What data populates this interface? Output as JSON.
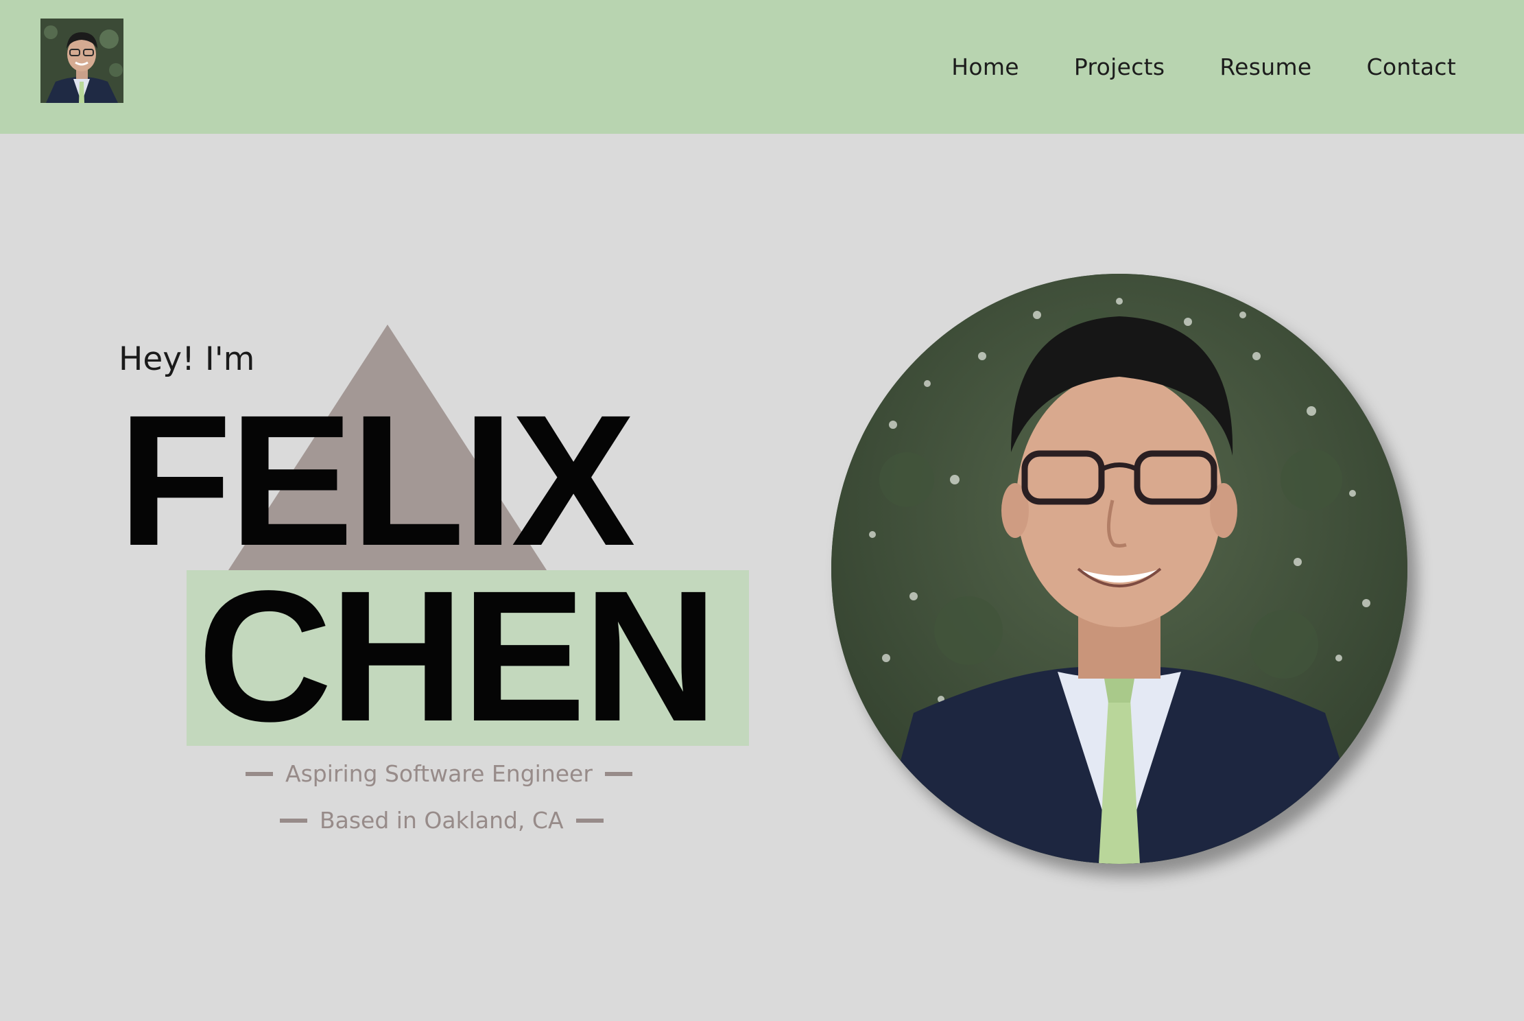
{
  "nav": {
    "logo_alt": "Felix Chen portrait thumbnail",
    "links": [
      {
        "label": "Home"
      },
      {
        "label": "Projects"
      },
      {
        "label": "Resume"
      },
      {
        "label": "Contact"
      }
    ]
  },
  "hero": {
    "greeting": "Hey! I'm",
    "first_name": "FELIX",
    "last_name": "CHEN",
    "tagline_role": "Aspiring Software Engineer",
    "tagline_location": "Based in Oakland, CA",
    "portrait_alt": "Portrait photo of Felix Chen"
  },
  "colors": {
    "navbar_bg": "#b8d4b0",
    "page_bg": "#dadada",
    "accent_green": "#c3d8bd",
    "accent_taupe": "#a39895",
    "tagline_text": "#978b89"
  }
}
